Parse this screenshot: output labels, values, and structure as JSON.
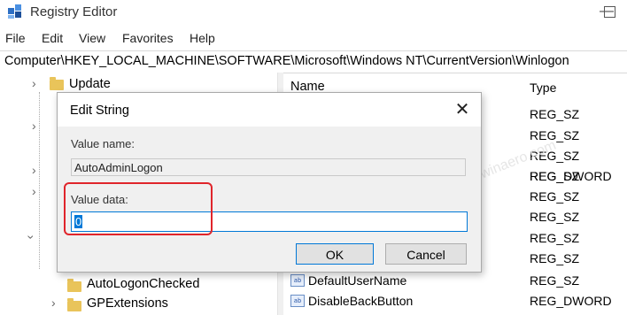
{
  "window": {
    "title": "Registry Editor",
    "min_glyph": "—"
  },
  "menu": [
    "File",
    "Edit",
    "View",
    "Favorites",
    "Help"
  ],
  "address": "Computer\\HKEY_LOCAL_MACHINE\\SOFTWARE\\Microsoft\\Windows NT\\CurrentVersion\\Winlogon",
  "tree": {
    "items": [
      {
        "label": "Update"
      },
      {
        "label": "AutoLogonChecked"
      },
      {
        "label": "GPExtensions"
      }
    ]
  },
  "list": {
    "columns": {
      "name": "Name",
      "type": "Type"
    },
    "types": [
      "REG_SZ",
      "REG_SZ",
      "REG_SZ",
      "REG_SZ",
      "REG_DWORD",
      "REG_SZ",
      "REG_SZ",
      "REG_SZ",
      "REG_SZ",
      "REG_SZ",
      "REG_DWORD"
    ],
    "visible_names": [
      "DefaultUserName",
      "DisableBackButton"
    ],
    "icon_text": "ab"
  },
  "dialog": {
    "title": "Edit String",
    "close_glyph": "✕",
    "value_name_label": "Value name:",
    "value_name": "AutoAdminLogon",
    "value_data_label": "Value data:",
    "value_data": "0",
    "ok_label": "OK",
    "cancel_label": "Cancel"
  },
  "watermark": "winaero.com"
}
